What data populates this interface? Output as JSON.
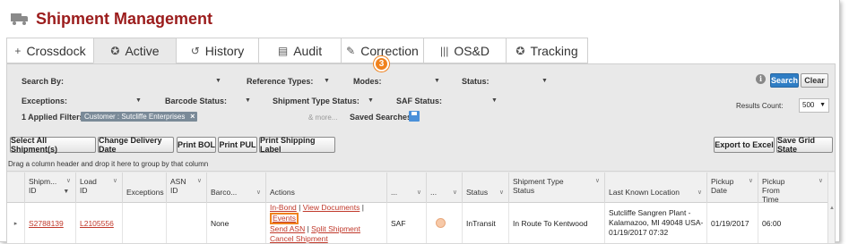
{
  "page": {
    "title": "Shipment Management"
  },
  "tabs": [
    {
      "label": "Crossdock",
      "icon": "+"
    },
    {
      "label": "Active",
      "icon": "✪"
    },
    {
      "label": "History",
      "icon": "↺"
    },
    {
      "label": "Audit",
      "icon": "▤"
    },
    {
      "label": "Correction",
      "icon": "✎"
    },
    {
      "label": "OS&D",
      "icon": "|||"
    },
    {
      "label": "Tracking",
      "icon": "✪"
    }
  ],
  "filters": {
    "search_by": "Search By:",
    "reference_types": "Reference Types:",
    "modes": "Modes:",
    "status": "Status:",
    "exceptions": "Exceptions:",
    "barcode_status": "Barcode Status:",
    "shipment_type_status": "Shipment Type Status:",
    "saf_status": "SAF Status:",
    "applied_filters": "1 Applied Filters:",
    "chip": "Customer : Sutcliffe Enterprises",
    "more": "& more...",
    "saved_searches": "Saved Searches:",
    "search_btn": "Search",
    "clear_btn": "Clear",
    "results_count_label": "Results Count:",
    "results_count_value": "500"
  },
  "toolbar": {
    "select_all": "Select All Shipment(s)",
    "change_delivery": "Change Delivery Date",
    "print_bol": "Print BOL",
    "print_pul": "Print PUL",
    "print_label": "Print Shipping Label",
    "export_excel": "Export to Excel",
    "save_grid": "Save Grid State"
  },
  "grid": {
    "group_hint": "Drag a column header and drop it here to group by that column",
    "headers": {
      "shipment_id": "Shipm... ID",
      "load_id": "Load ID",
      "exceptions": "Exceptions",
      "asn_id": "ASN ID",
      "barcode": "Barco...",
      "actions": "Actions",
      "col_a": "...",
      "col_b": "...",
      "status": "Status",
      "shipment_type_status": "Shipment Type Status",
      "last_known_location": "Last Known Location",
      "pickup_date": "Pickup Date",
      "pickup_from_time": "Pickup From Time"
    },
    "row": {
      "shipment_id": "S2788139",
      "load_id": "L2105556",
      "exceptions": "",
      "asn_id": "",
      "barcode": "None",
      "actions": {
        "in_bond": "In-Bond",
        "view_documents": "View Documents",
        "events": "Events",
        "send_asn": "Send ASN",
        "split_shipment": "Split Shipment",
        "cancel_shipment": "Cancel Shipment"
      },
      "col_a": "SAF",
      "status": "InTransit",
      "shipment_type_status": "In Route To Kentwood",
      "last_known_location_1": "Sutcliffe Sangren Plant -",
      "last_known_location_2": "Kalamazoo, MI 49048 USA-",
      "last_known_location_3": "01/19/2017 07:32",
      "pickup_date": "01/19/2017",
      "pickup_from_time": "06:00"
    },
    "callout_number": "3"
  },
  "colors": {
    "brand": "#9b1c1c",
    "link": "#c0392b",
    "highlight": "#f0821e",
    "primary_button": "#2f7dc4"
  }
}
